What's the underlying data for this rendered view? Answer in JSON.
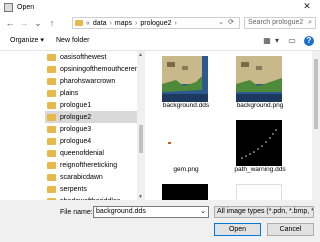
{
  "window": {
    "title": "Open",
    "close_glyph": "✕"
  },
  "address": {
    "back": "←",
    "forward": "→",
    "history": "⌄",
    "up": "↑",
    "prefix": "«",
    "separator": "›",
    "crumbs": [
      "data",
      "maps",
      "prologue2"
    ],
    "dropdown": "⌄",
    "refresh": "⟳"
  },
  "search": {
    "placeholder": "Search prologue2",
    "icon": "⌕"
  },
  "toolbar": {
    "organize": "Organize ▾",
    "new_folder": "New folder",
    "view": "▦",
    "view_dd": "▾",
    "pane": "▭",
    "help": "?"
  },
  "nav": {
    "items": [
      "oasisofthewest",
      "opsiningofthemouthceremony",
      "pharohswarcrown",
      "plains",
      "prologue1",
      "prologue2",
      "prologue3",
      "prologue4",
      "queenofdenial",
      "reignofthereticking",
      "scarabicdawn",
      "serpents",
      "shadowoftheriddles"
    ],
    "selected_index": 5
  },
  "files": [
    {
      "name": "background.dds",
      "selected": true
    },
    {
      "name": "background.png",
      "selected": false
    },
    {
      "name": "gem.png",
      "selected": false
    },
    {
      "name": "path_warning.dds",
      "selected": false
    },
    {
      "name": "",
      "selected": false
    },
    {
      "name": "",
      "selected": false
    }
  ],
  "bottom": {
    "filename_label": "File name:",
    "filename_value": "background.dds",
    "filetype": "All image types (*.pdn, *.bmp, *.",
    "dropdown": "⌄",
    "open": "Open",
    "cancel": "Cancel"
  }
}
